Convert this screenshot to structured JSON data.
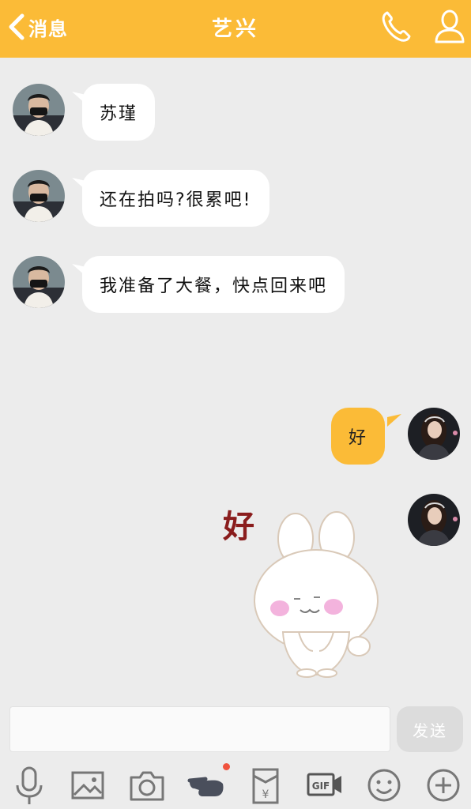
{
  "header": {
    "back_label": "消息",
    "title": "艺兴"
  },
  "messages": [
    {
      "side": "left",
      "text": "苏瑾"
    },
    {
      "side": "left",
      "text": "还在拍吗?很累吧!"
    },
    {
      "side": "left",
      "text": "我准备了大餐，快点回来吧"
    },
    {
      "side": "right",
      "text": "好"
    },
    {
      "side": "right",
      "sticker_text": "好"
    }
  ],
  "composer": {
    "input_value": "",
    "send_label": "发送"
  },
  "toolbar": {
    "icons": [
      "microphone-icon",
      "image-icon",
      "camera-icon",
      "poke-hand-icon",
      "red-packet-icon",
      "gif-icon",
      "emoji-icon",
      "plus-icon"
    ]
  },
  "colors": {
    "accent": "#fbbb37",
    "background": "#ececec",
    "bubble_left": "#ffffff",
    "bubble_right": "#fbbb37",
    "notification_dot": "#f0533e"
  }
}
